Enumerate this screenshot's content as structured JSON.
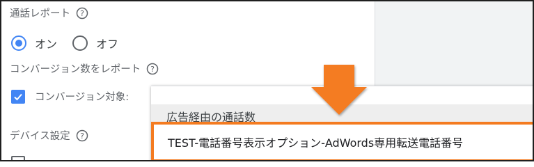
{
  "call_report": {
    "title": "通話レポート",
    "options": [
      {
        "label": "オン",
        "selected": true
      },
      {
        "label": "オフ",
        "selected": false
      }
    ]
  },
  "conversion_report": {
    "title": "コンバージョン数をレポート",
    "checkbox_label": "コンバージョン対象:",
    "checked": true
  },
  "device_settings": {
    "title": "デバイス設定"
  },
  "dropdown": {
    "options": [
      {
        "label": "広告経由の通話数"
      },
      {
        "label": "TEST-電話番号表示オプション-AdWords専用転送電話番号"
      }
    ],
    "highlighted_index": 1
  },
  "colors": {
    "accent": "#4285f4",
    "highlight_border": "#f47b20",
    "arrow": "#f47b20"
  },
  "icons": {
    "help": "help-circle-icon",
    "arrow": "down-arrow-icon",
    "check": "check-icon"
  }
}
